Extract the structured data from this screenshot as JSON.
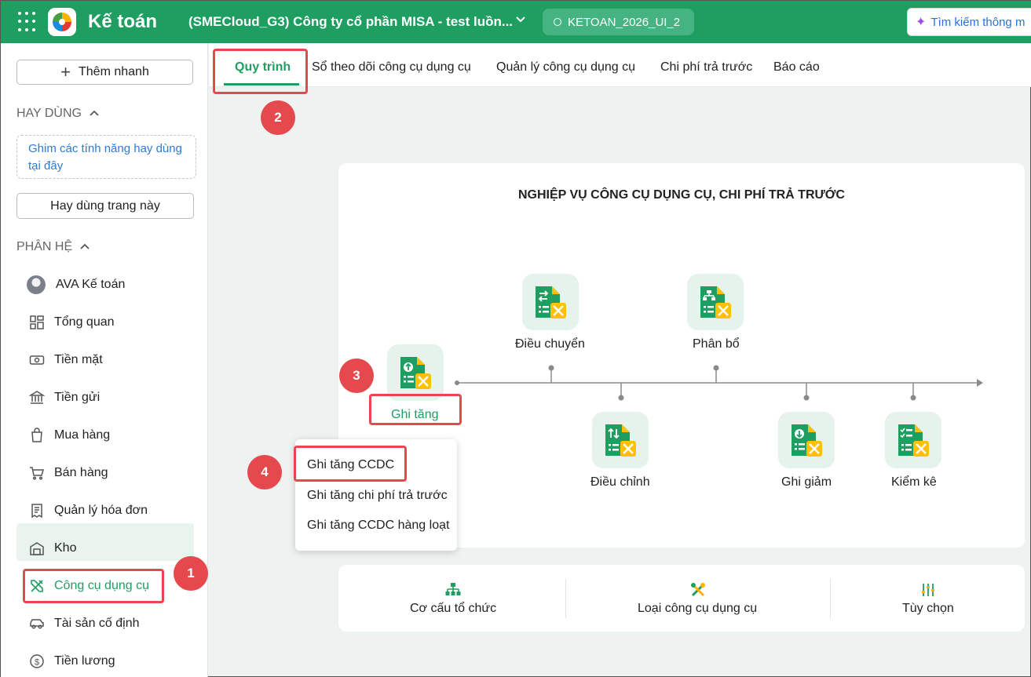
{
  "header": {
    "app_title": "Kế toán",
    "company": "(SMECloud_G3) Công ty cổ phần MISA - test luồn...",
    "database": "KETOAN_2026_UI_2",
    "search_placeholder": "Tìm kiếm thông m",
    "brand_color": "#1f9e62"
  },
  "sidebar": {
    "quick_add": "Thêm nhanh",
    "favorites_section": "HAY DÙNG",
    "pin_hint": "Ghim các tính năng hay dùng tại đây",
    "favorite_page": "Hay dùng trang này",
    "modules_section": "PHÂN HỆ",
    "items": [
      {
        "label": "AVA Kế toán",
        "icon": "avatar"
      },
      {
        "label": "Tổng quan",
        "icon": "dashboard-icon"
      },
      {
        "label": "Tiền mặt",
        "icon": "cash-icon"
      },
      {
        "label": "Tiền gửi",
        "icon": "bank-icon"
      },
      {
        "label": "Mua hàng",
        "icon": "shopping-bag-icon"
      },
      {
        "label": "Bán hàng",
        "icon": "cart-icon"
      },
      {
        "label": "Quản lý hóa đơn",
        "icon": "invoice-icon"
      },
      {
        "label": "Kho",
        "icon": "warehouse-icon"
      },
      {
        "label": "Công cụ dụng cụ",
        "icon": "tools-icon"
      },
      {
        "label": "Tài sản cố định",
        "icon": "car-icon"
      },
      {
        "label": "Tiền lương",
        "icon": "dollar-icon"
      }
    ]
  },
  "tabs": [
    "Quy trình",
    "Sổ theo dõi công cụ dụng cụ",
    "Quản lý công cụ dụng cụ",
    "Chi phí trả trước",
    "Báo cáo"
  ],
  "workflow": {
    "title": "NGHIỆP VỤ CÔNG CỤ DỤNG CỤ, CHI PHÍ TRẢ TRƯỚC",
    "nodes": {
      "increase": "Ghi tăng",
      "transfer": "Điều chuyển",
      "adjust": "Điều chỉnh",
      "allocate": "Phân bổ",
      "decrease": "Ghi giảm",
      "inventory": "Kiểm kê"
    }
  },
  "dropdown": [
    "Ghi tăng CCDC",
    "Ghi tăng chi phí trả trước",
    "Ghi tăng CCDC hàng loạt"
  ],
  "settings": [
    "Cơ cấu tổ chức",
    "Loại công cụ dụng cụ",
    "Tùy chọn"
  ],
  "annotations": [
    "1",
    "2",
    "3",
    "4"
  ],
  "annotation_color": "#e5484d"
}
